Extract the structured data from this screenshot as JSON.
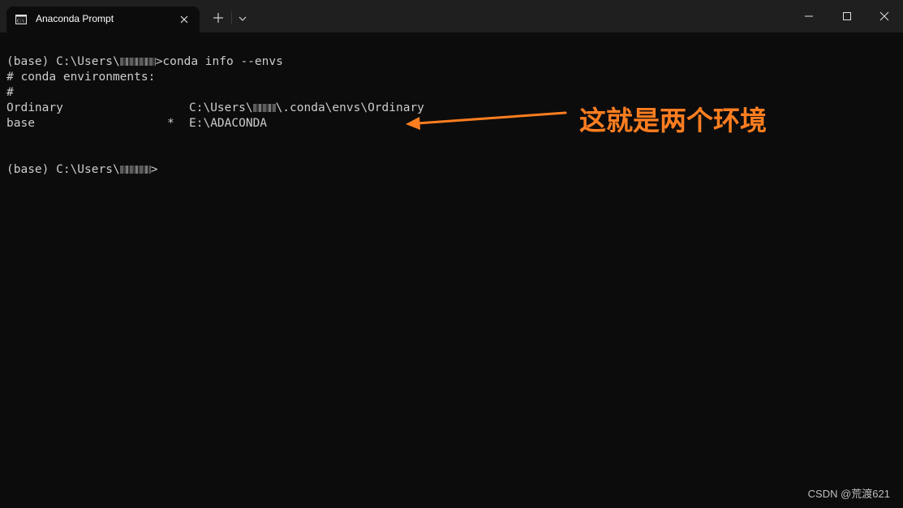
{
  "window": {
    "tab_title": "Anaconda Prompt",
    "icons": {
      "tab": "terminal-icon",
      "close_tab": "close-icon",
      "new_tab": "plus-icon",
      "dropdown": "chevron-down-icon",
      "minimize": "minimize-icon",
      "maximize": "maximize-icon",
      "close_window": "close-icon"
    }
  },
  "terminal": {
    "line1_pre": "(base) C:\\Users\\",
    "line1_post": ">conda info --envs",
    "line2": "# conda environments:",
    "line3": "#",
    "env1_name": "Ordinary",
    "env1_path_pre": "C:\\Users\\",
    "env1_path_post": "\\.conda\\envs\\Ordinary",
    "env2_name": "base",
    "env2_active": "*",
    "env2_path": "E:\\ADACONDA",
    "prompt_pre": "(base) C:\\Users\\",
    "prompt_post": ">"
  },
  "annotation": {
    "text": "这就是两个环境",
    "color": "#ff7e20"
  },
  "watermark": "CSDN @荒渡621",
  "colors": {
    "terminal_bg": "#0c0c0c",
    "titlebar_bg": "#1f1f1f",
    "text": "#cccccc"
  }
}
